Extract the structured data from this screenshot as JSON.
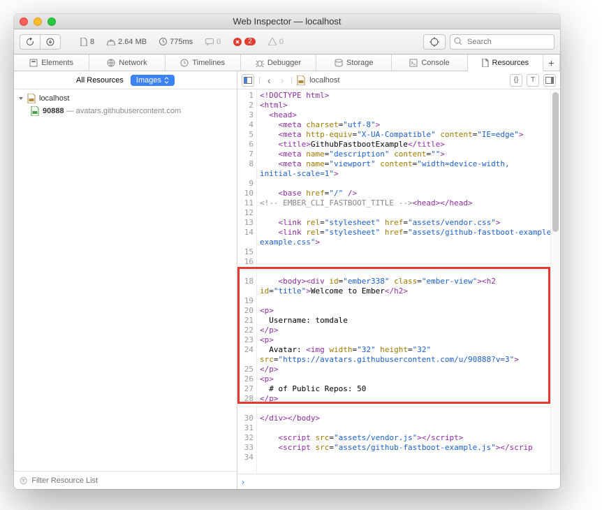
{
  "window": {
    "title": "Web Inspector — localhost"
  },
  "toolbar": {
    "doc_count": "8",
    "size": "2.64 MB",
    "time": "775ms",
    "msg_count": "0",
    "err_count": "2",
    "warn_count": "0",
    "search_placeholder": "Search"
  },
  "tabs": [
    {
      "label": "Elements"
    },
    {
      "label": "Network"
    },
    {
      "label": "Timelines"
    },
    {
      "label": "Debugger"
    },
    {
      "label": "Storage"
    },
    {
      "label": "Console"
    },
    {
      "label": "Resources"
    }
  ],
  "sidebar": {
    "head_label": "All Resources",
    "filter_label": "Images",
    "root": "localhost",
    "item_name": "90888",
    "item_host": " — avatars.githubusercontent.com",
    "filter_placeholder": "Filter Resource List"
  },
  "breadcrumb": {
    "name": "localhost"
  },
  "chart_data": {
    "type": "table",
    "note": "HTML source view lines",
    "lines": [
      {
        "n": 1
      },
      {
        "n": 2
      },
      {
        "n": 3
      },
      {
        "n": 4
      },
      {
        "n": 5
      },
      {
        "n": 6
      },
      {
        "n": 7
      },
      {
        "n": 8
      },
      {
        "n": ""
      },
      {
        "n": 9
      },
      {
        "n": 10
      },
      {
        "n": 11
      },
      {
        "n": 12
      },
      {
        "n": 13
      },
      {
        "n": 14
      },
      {
        "n": ""
      },
      {
        "n": 15
      },
      {
        "n": 16
      },
      {
        "n": ""
      },
      {
        "n": 18
      },
      {
        "n": ""
      },
      {
        "n": 19
      },
      {
        "n": 20
      },
      {
        "n": 21
      },
      {
        "n": 22
      },
      {
        "n": 23
      },
      {
        "n": 24
      },
      {
        "n": ""
      },
      {
        "n": 25
      },
      {
        "n": 26
      },
      {
        "n": 27
      },
      {
        "n": 28
      },
      {
        "n": ""
      },
      {
        "n": 30
      },
      {
        "n": 31
      },
      {
        "n": 32
      },
      {
        "n": 33
      },
      {
        "n": 34
      }
    ],
    "source": {
      "title_text": "GithubFastbootExample",
      "body_h2": "Welcome to Ember",
      "username_line": "  Username: tomdale",
      "avatar_width": "32",
      "avatar_height": "32",
      "avatar_src": "https://avatars.githubusercontent.com/u/90888?v=3",
      "repos_line": "  # of Public Repos: 50",
      "vendor_css": "assets/vendor.css",
      "app_css": "assets/github-fastboot-example.css",
      "vendor_js": "assets/vendor.js",
      "app_js": "assets/github-fastboot-example.js"
    }
  }
}
